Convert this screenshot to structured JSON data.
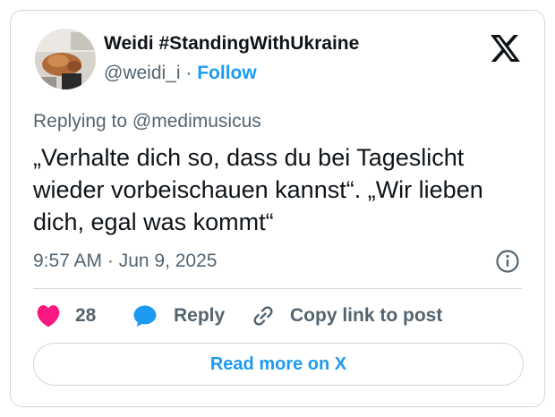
{
  "author": {
    "display_name": "Weidi #StandingWithUkraine",
    "handle": "@weidi_i",
    "separator": "·",
    "follow_label": "Follow",
    "avatar_icon": "user-avatar-photo"
  },
  "platform": {
    "logo_icon": "x-logo-icon"
  },
  "reply_context": {
    "prefix": "Replying to",
    "mention": "@medimusicus"
  },
  "tweet": {
    "text": "„Verhalte dich so, dass du bei Tageslicht wieder vorbeischauen kannst“. „Wir lieben dich, egal was kommt“",
    "timestamp": "9:57 AM · Jun 9, 2025"
  },
  "actions": {
    "like_count": "28",
    "reply_label": "Reply",
    "copy_label": "Copy link to post"
  },
  "read_more_label": "Read more on X",
  "colors": {
    "accent": "#1d9bf0",
    "like": "#f91880",
    "muted": "#536471",
    "text": "#0f1419",
    "border": "#cfd9de"
  }
}
